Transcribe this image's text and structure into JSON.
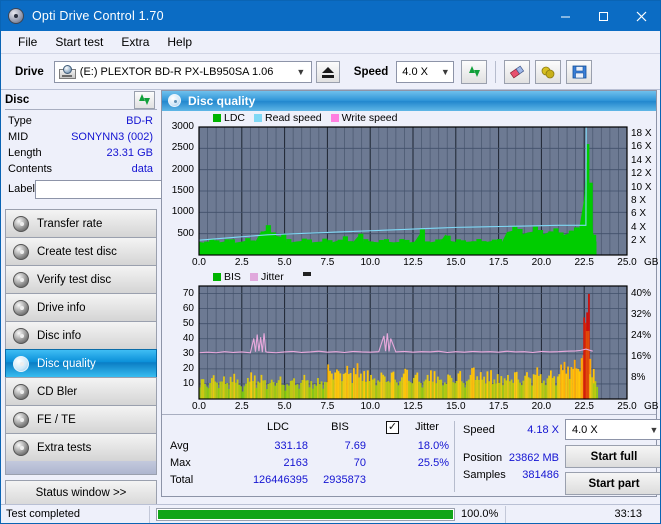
{
  "window": {
    "title": "Opti Drive Control 1.70",
    "icon": "optical-disc-icon",
    "minimize": "minimize",
    "maximize": "maximize",
    "close": "close"
  },
  "menu": {
    "items": [
      "File",
      "Start test",
      "Extra",
      "Help"
    ]
  },
  "toolbar": {
    "drive_label": "Drive",
    "drive_value": "(E:)  PLEXTOR BD-R  PX-LB950SA 1.06",
    "eject": "eject",
    "speed_label": "Speed",
    "speed_value": "4.0 X",
    "refresh": "refresh",
    "erase": "erase",
    "lock": "lock",
    "save": "save"
  },
  "disc": {
    "header": "Disc",
    "refresh": "refresh",
    "rows": [
      {
        "key": "Type",
        "value": "BD-R"
      },
      {
        "key": "MID",
        "value": "SONYNN3 (002)"
      },
      {
        "key": "Length",
        "value": "23.31 GB"
      },
      {
        "key": "Contents",
        "value": "data"
      }
    ],
    "label_key": "Label",
    "label_value": "",
    "label_placeholder": ""
  },
  "sidebar": {
    "items": [
      {
        "label": "Transfer rate",
        "active": false
      },
      {
        "label": "Create test disc",
        "active": false
      },
      {
        "label": "Verify test disc",
        "active": false
      },
      {
        "label": "Drive info",
        "active": false
      },
      {
        "label": "Disc info",
        "active": false
      },
      {
        "label": "Disc quality",
        "active": true
      },
      {
        "label": "CD Bler",
        "active": false
      },
      {
        "label": "FE / TE",
        "active": false
      },
      {
        "label": "Extra tests",
        "active": false
      }
    ],
    "status_window": "Status window >>"
  },
  "panel": {
    "title": "Disc quality",
    "icon": "disc-quality-icon"
  },
  "stats": {
    "col_ldc": "LDC",
    "col_bis": "BIS",
    "jitter_label": "Jitter",
    "jitter_checked": true,
    "check_glyph": "✓",
    "rows": [
      {
        "key": "Avg",
        "ldc": "331.18",
        "bis": "7.69",
        "jitter": "18.0%"
      },
      {
        "key": "Max",
        "ldc": "2163",
        "bis": "70",
        "jitter": "25.5%"
      },
      {
        "key": "Total",
        "ldc": "126446395",
        "bis": "2935873",
        "jitter": ""
      }
    ]
  },
  "readout": {
    "speed_key": "Speed",
    "speed_value": "4.18 X",
    "position_key": "Position",
    "position_value": "23862 MB",
    "samples_key": "Samples",
    "samples_value": "381486",
    "speed_select": "4.0 X",
    "start_full": "Start full",
    "start_part": "Start part"
  },
  "statusbar": {
    "text": "Test completed",
    "progress_pct": "100.0%",
    "progress_value": 100,
    "time": "33:13"
  },
  "colors": {
    "ldc_green": "#00cc00",
    "read_speed": "#7fd8f5",
    "write_speed": "#ff7fe0",
    "bis_green": "#00cc00",
    "jitter_pink": "#e8a8dc",
    "plot_bg": "#6d7a93",
    "accent_blue": "#0b6cc4",
    "value_blue": "#1414d2"
  },
  "chart_data": [
    {
      "type": "area",
      "name": "disc-quality-ldc",
      "title": "",
      "xlabel": "GB",
      "ylabel": "",
      "xlim": [
        0.0,
        25.0
      ],
      "ylim": [
        0,
        3000
      ],
      "xticks": [
        "0.0",
        "2.5",
        "5.0",
        "7.5",
        "10.0",
        "12.5",
        "15.0",
        "17.5",
        "20.0",
        "22.5",
        "25.0"
      ],
      "yticks": [
        "500",
        "1000",
        "1500",
        "2000",
        "2500",
        "3000"
      ],
      "y2ticks": [
        "2 X",
        "4 X",
        "6 X",
        "8 X",
        "10 X",
        "12 X",
        "14 X",
        "16 X",
        "18 X"
      ],
      "y2lim": [
        0,
        19
      ],
      "grid": true,
      "legend": [
        {
          "label": "LDC",
          "color": "#00b400"
        },
        {
          "label": "Read speed",
          "color": "#7fd8f5"
        },
        {
          "label": "Write speed",
          "color": "#ff7fe0"
        }
      ],
      "series": [
        {
          "name": "LDC",
          "kind": "area",
          "color": "#00cc00",
          "x": [
            0.0,
            0.3,
            0.6,
            0.9,
            1.2,
            1.5,
            1.8,
            2.1,
            2.4,
            2.7,
            3.0,
            3.3,
            3.6,
            3.9,
            4.2,
            4.5,
            4.8,
            5.1,
            5.4,
            5.7,
            6.0,
            6.3,
            6.6,
            6.9,
            7.2,
            7.5,
            7.8,
            8.1,
            8.4,
            8.7,
            9.0,
            9.3,
            9.6,
            9.9,
            10.2,
            10.5,
            10.8,
            11.1,
            11.4,
            11.7,
            12.0,
            12.3,
            12.6,
            12.9,
            13.2,
            13.5,
            13.8,
            14.1,
            14.4,
            14.7,
            15.0,
            15.3,
            15.6,
            15.9,
            16.2,
            16.5,
            16.8,
            17.1,
            17.4,
            17.7,
            18.0,
            18.3,
            18.6,
            18.9,
            19.2,
            19.5,
            19.8,
            20.1,
            20.4,
            20.7,
            21.0,
            21.3,
            21.6,
            21.9,
            22.2,
            22.5,
            22.65,
            22.8,
            23.0,
            23.2
          ],
          "values": [
            300,
            280,
            300,
            330,
            290,
            310,
            300,
            280,
            300,
            320,
            290,
            300,
            520,
            560,
            480,
            440,
            420,
            300,
            290,
            310,
            320,
            300,
            290,
            300,
            310,
            300,
            290,
            330,
            350,
            300,
            290,
            430,
            300,
            320,
            300,
            290,
            310,
            300,
            290,
            300,
            310,
            290,
            300,
            480,
            300,
            290,
            310,
            300,
            470,
            320,
            300,
            290,
            300,
            310,
            300,
            290,
            300,
            320,
            300,
            290,
            530,
            560,
            500,
            480,
            520,
            540,
            500,
            480,
            520,
            500,
            480,
            460,
            500,
            520,
            560,
            1280,
            2163,
            1400,
            520,
            300
          ]
        },
        {
          "name": "Read speed",
          "kind": "line",
          "color": "#7fd8f5",
          "axis": "y2",
          "x": [
            0.0,
            1.0,
            2.0,
            3.0,
            4.0,
            5.0,
            6.0,
            7.0,
            8.0,
            9.0,
            10.0,
            11.0,
            12.0,
            13.0,
            14.0,
            15.0,
            16.0,
            17.0,
            18.0,
            19.0,
            20.0,
            21.0,
            22.0,
            22.6,
            22.62,
            23.2
          ],
          "values": [
            2.2,
            2.4,
            2.6,
            2.8,
            3.0,
            3.1,
            3.2,
            3.3,
            3.4,
            3.5,
            3.6,
            3.7,
            3.8,
            3.9,
            4.0,
            4.1,
            4.15,
            4.2,
            4.25,
            4.3,
            4.35,
            4.4,
            4.4,
            4.4,
            19.0,
            19.0
          ]
        }
      ]
    },
    {
      "type": "bar",
      "name": "disc-quality-bis",
      "title": "",
      "xlabel": "GB",
      "ylabel": "",
      "xlim": [
        0.0,
        25.0
      ],
      "ylim": [
        0,
        75
      ],
      "xticks": [
        "0.0",
        "2.5",
        "5.0",
        "7.5",
        "10.0",
        "12.5",
        "15.0",
        "17.5",
        "20.0",
        "22.5",
        "25.0"
      ],
      "yticks": [
        "10",
        "20",
        "30",
        "40",
        "50",
        "60",
        "70"
      ],
      "y2ticks": [
        "8%",
        "16%",
        "24%",
        "32%",
        "40%"
      ],
      "y2lim": [
        0,
        43
      ],
      "grid": true,
      "legend": [
        {
          "label": "BIS",
          "color": "#00b400"
        },
        {
          "label": "Jitter",
          "color": "#e0a8dc"
        }
      ],
      "series": [
        {
          "name": "BIS",
          "kind": "bars",
          "x": [
            0.1,
            0.4,
            0.7,
            1.0,
            1.3,
            1.6,
            1.9,
            2.2,
            2.5,
            2.8,
            3.1,
            3.4,
            3.7,
            4.0,
            4.3,
            4.6,
            4.9,
            5.2,
            5.5,
            5.8,
            6.1,
            6.4,
            6.7,
            7.0,
            7.3,
            7.6,
            7.9,
            8.2,
            8.5,
            8.8,
            9.1,
            9.4,
            9.7,
            10.0,
            10.3,
            10.6,
            10.9,
            11.2,
            11.5,
            11.8,
            12.1,
            12.4,
            12.7,
            13.0,
            13.3,
            13.6,
            13.9,
            14.2,
            14.5,
            14.8,
            15.1,
            15.4,
            15.7,
            16.0,
            16.3,
            16.6,
            16.9,
            17.2,
            17.5,
            17.8,
            18.1,
            18.4,
            18.7,
            19.0,
            19.3,
            19.6,
            19.9,
            20.2,
            20.5,
            20.8,
            21.1,
            21.4,
            21.7,
            22.0,
            22.3,
            22.55,
            22.62,
            22.7,
            22.9,
            23.1
          ],
          "values": [
            14,
            10,
            16,
            12,
            15,
            11,
            17,
            13,
            9,
            14,
            18,
            12,
            16,
            11,
            13,
            15,
            10,
            12,
            14,
            11,
            16,
            13,
            10,
            14,
            12,
            23,
            20,
            19,
            22,
            18,
            24,
            17,
            20,
            16,
            14,
            18,
            15,
            19,
            13,
            17,
            21,
            14,
            18,
            12,
            16,
            20,
            15,
            13,
            17,
            14,
            19,
            12,
            16,
            22,
            18,
            15,
            20,
            13,
            17,
            14,
            16,
            19,
            13,
            18,
            15,
            21,
            17,
            14,
            19,
            16,
            23,
            25,
            22,
            26,
            30,
            55,
            70,
            48,
            20,
            12
          ]
        },
        {
          "name": "Jitter",
          "kind": "line",
          "color": "#e8a8dc",
          "axis": "y2",
          "x": [
            0.0,
            0.5,
            1.0,
            1.5,
            2.0,
            2.5,
            3.0,
            3.2,
            3.3,
            3.4,
            3.5,
            3.6,
            3.7,
            3.8,
            3.9,
            4.0,
            4.5,
            5.0,
            5.5,
            6.0,
            6.5,
            7.0,
            7.5,
            8.0,
            8.5,
            9.0,
            9.5,
            10.0,
            10.5,
            10.8,
            10.9,
            11.0,
            11.1,
            11.2,
            11.5,
            12.0,
            12.5,
            13.0,
            13.5,
            14.0,
            14.5,
            15.0,
            15.5,
            16.0,
            16.5,
            17.0,
            17.5,
            18.0,
            18.5,
            19.0,
            19.5,
            20.0,
            20.5,
            21.0,
            21.5,
            22.0,
            22.3,
            22.6,
            23.0
          ],
          "values": [
            17.6,
            17.8,
            17.6,
            18.0,
            17.7,
            17.9,
            17.6,
            23.0,
            18.0,
            24.5,
            18.2,
            23.5,
            17.8,
            25.0,
            18.0,
            17.8,
            17.6,
            17.9,
            18.1,
            17.7,
            17.9,
            18.2,
            17.8,
            18.0,
            17.7,
            18.1,
            17.9,
            17.8,
            18.0,
            24.0,
            18.2,
            25.0,
            18.1,
            23.0,
            17.9,
            18.1,
            17.8,
            18.0,
            17.9,
            18.2,
            17.7,
            18.0,
            17.8,
            18.1,
            17.9,
            18.0,
            17.8,
            18.2,
            17.9,
            18.0,
            17.7,
            18.1,
            17.9,
            18.0,
            18.2,
            18.3,
            18.5,
            19.0,
            18.2
          ]
        }
      ]
    }
  ]
}
